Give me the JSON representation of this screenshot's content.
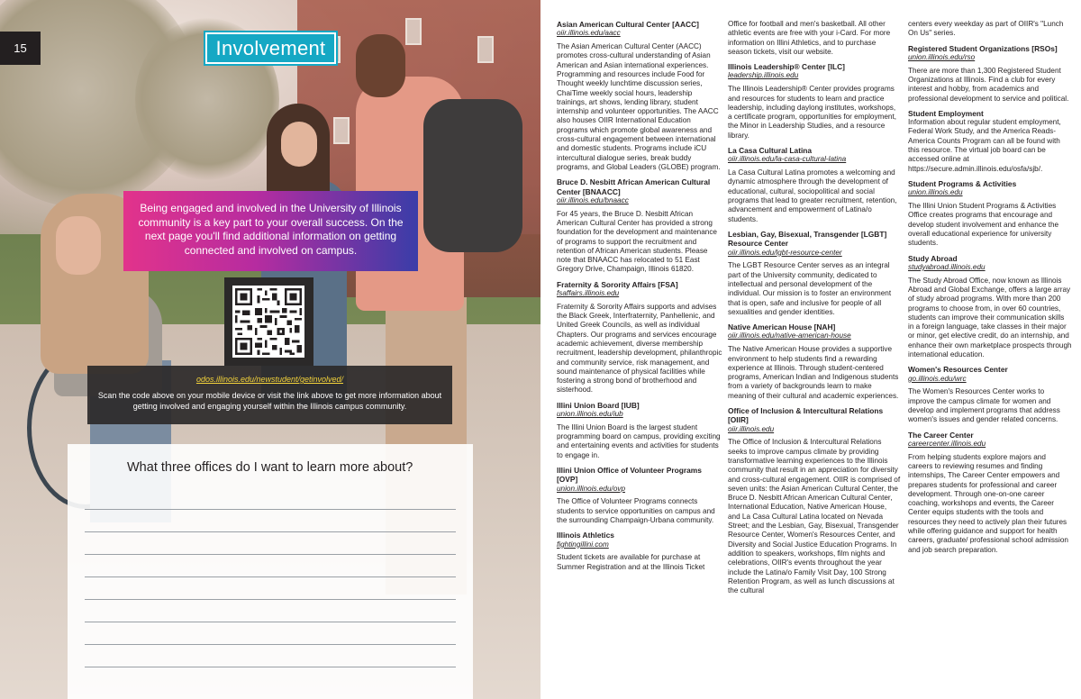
{
  "left_page": {
    "page_number": "15",
    "section_title": "Involvement",
    "intro_text": "Being engaged and involved in the University of Illinois community is a key part to your overall success. On the next page you'll find additional information on getting connected and involved on campus.",
    "scan_link": "odos.illinois.edu/newstudent/getinvolved/",
    "scan_text": "Scan the code above on your mobile device or visit the link above to get more information about getting involved and engaging yourself within the Illinois campus community.",
    "notes_question": "What three offices do I want to learn more about?"
  },
  "right_page": {
    "col1": [
      {
        "title": "Asian American Cultural Center [AACC]",
        "url": "oiir.illinois.edu/aacc",
        "body": "The Asian American Cultural Center (AACC) promotes cross-cultural understanding of Asian American and Asian international experiences. Programming and resources include Food for Thought weekly lunchtime discussion series, ChaiTime weekly social hours, leadership trainings, art shows, lending library, student internship and volunteer opportunities. The AACC also houses OIIR International Education programs which promote global awareness and cross-cultural engagement between international and domestic students. Programs include iCU intercultural dialogue series, break buddy programs, and Global Leaders (GLOBE) program."
      },
      {
        "title": "Bruce D. Nesbitt African American Cultural Center [BNAACC]",
        "url": "oiir.illinois.edu/bnaacc",
        "body": "For 45 years, the Bruce D. Nesbitt African American Cultural Center has provided a strong foundation for the development and maintenance of programs to support the recruitment and retention of African American students. Please note that BNAACC has relocated to 51 East Gregory Drive, Champaign, Illinois 61820."
      },
      {
        "title": "Fraternity & Sorority Affairs [FSA]",
        "url": "fsaffairs.illinois.edu",
        "body": "Fraternity & Sorority Affairs supports and advises the Black Greek, Interfraternity, Panhellenic, and United Greek Councils, as well as individual Chapters. Our programs and services encourage academic achievement, diverse membership recruitment, leadership development, philanthropic and community service, risk management, and sound maintenance of physical facilities while fostering a strong bond of brotherhood and sisterhood."
      },
      {
        "title": "Illini Union Board [IUB]",
        "url": "union.illinois.edu/iub",
        "body": "The Illini Union Board is the largest student programming board on campus, providing exciting and entertaining events and activities for students to engage in."
      },
      {
        "title": "Illini Union Office of Volunteer Programs [OVP]",
        "url": "union.illinois.edu/ovp",
        "body": "The Office of Volunteer Programs connects students to service opportunities on campus and the surrounding Champaign-Urbana community."
      },
      {
        "title": "Illinois Athletics",
        "url": "fightingillini.com",
        "body": "Student tickets are available for purchase at Summer Registration and at the Illinois Ticket"
      }
    ],
    "col2_continuation": "Office for football and men's basketball. All other athletic events are free with your i-Card. For more information on Illini Athletics, and to purchase season tickets, visit our website.",
    "col2": [
      {
        "title": "Illinois Leadership® Center [ILC]",
        "url": "leadership.illinois.edu",
        "body": "The Illinois Leadership® Center provides programs and resources for students to learn and practice leadership, including daylong institutes, workshops, a certificate program, opportunities for employment, the Minor in Leadership Studies, and a resource library."
      },
      {
        "title": "La Casa Cultural Latina",
        "url": "oiir.illinois.edu/la-casa-cultural-latina",
        "body": "La Casa Cultural Latina promotes a welcoming and dynamic atmosphere through the development of educational, cultural, sociopolitical and social programs that lead to greater recruitment, retention, advancement and empowerment of Latina/o students."
      },
      {
        "title": "Lesbian, Gay, Bisexual, Transgender [LGBT] Resource Center",
        "url": "oiir.illinois.edu/lgbt-resource-center",
        "body": "The LGBT Resource Center serves as an integral part of the University community, dedicated to intellectual and personal development of the individual. Our mission is to foster an environment that is open, safe and inclusive for people of all sexualities and gender identities."
      },
      {
        "title": "Native American House [NAH]",
        "url": "oiir.illinois.edu/native-american-house",
        "body": "The Native American House provides a supportive environment to help students find a rewarding experience at Illinois.  Through student-centered programs, American Indian and Indigenous students from a variety of backgrounds learn to make meaning of their cultural and academic experiences."
      },
      {
        "title": "Office of Inclusion & Intercultural Relations [OIIR]",
        "url": "oiir.illinois.edu",
        "body": "The Office of Inclusion & Intercultural Relations seeks to improve campus climate by providing transformative learning experiences to the Illinois community that result in an appreciation for diversity and cross-cultural engagement. OIIR is comprised of seven units: the Asian American Cultural Center, the Bruce D. Nesbitt African American Cultural Center, International Education, Native American House, and La Casa Cultural Latina located on Nevada Street; and the Lesbian, Gay, Bisexual, Transgender Resource Center, Women's Resources Center, and Diversity and Social Justice Education Programs. In addition to speakers, workshops, film nights and celebrations, OIIR's events throughout the year include the Latina/o Family Visit Day, 100 Strong Retention Program, as well as lunch discussions at the cultural"
      }
    ],
    "col3_continuation": "centers every weekday as part of OIIR's \"Lunch On Us\" series.",
    "col3": [
      {
        "title": "Registered Student Organizations [RSOs]",
        "url": "union.illinois.edu/rso",
        "body": "There are more than 1,300 Registered Student Organizations at Illinois. Find a club for every interest and hobby, from academics and professional development to service and political."
      },
      {
        "title": "Student Employment",
        "url": "",
        "body": "Information about regular student employment, Federal Work Study, and the America Reads-America Counts Program can all be found with this resource. The virtual job board can be accessed online at https://secure.admin.illinois.edu/osfa/sjb/."
      },
      {
        "title": "Student Programs & Activities",
        "url": "union.illinois.edu",
        "body": "The Illini Union Student Programs & Activities Office creates programs that encourage and develop student involvement and enhance the overall educational experience for university students."
      },
      {
        "title": "Study Abroad",
        "url": "studyabroad.illinois.edu",
        "body": "The Study Abroad Office, now known as Illinois Abroad and Global Exchange, offers a large array of study abroad programs. With more than 200 programs to choose from, in over 60 countries, students can improve their communication skills in a foreign language, take classes in their major or minor, get elective credit, do an internship, and enhance their own marketplace prospects through international education."
      },
      {
        "title": "Women's Resources Center",
        "url": "go.illinois.edu/wrc",
        "body": "The Women's Resources Center works to improve the campus climate for women and develop and implement programs that address women's issues and gender related concerns."
      },
      {
        "title": "The Career Center",
        "url": "careercenter.illinois.edu",
        "body": "From helping students explore majors and careers to reviewing resumes and finding internships, The Career Center empowers and prepares students for professional and career development. Through one-on-one career coaching, workshops and events, the Career Center equips students with the tools and resources they need to actively plan their futures while offering guidance and support for health careers, graduate/ professional school admission and job search preparation."
      }
    ]
  },
  "colors": {
    "section_tab": "#15a8c4",
    "intro_gradient_start": "#e2338b",
    "intro_gradient_end": "#3a3da8",
    "scan_link": "#f3d33b",
    "dark_box": "#2b2929"
  }
}
